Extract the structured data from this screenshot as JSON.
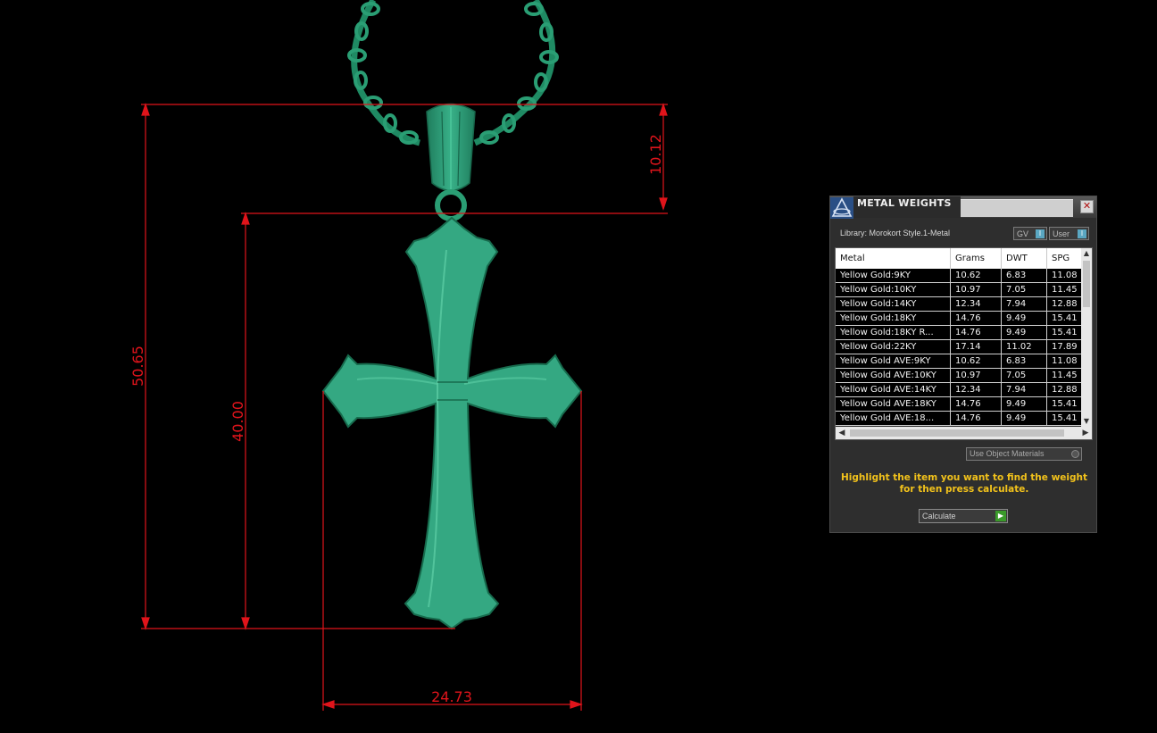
{
  "viewport": {
    "dimensions": {
      "overall_height": "50.65",
      "cross_height": "40.00",
      "bail_height": "10.12",
      "width": "24.73"
    },
    "colors": {
      "metal": "#2f9e77",
      "dimension_lines": "#e0141b",
      "background": "#000000"
    }
  },
  "panel": {
    "title": "METAL WEIGHTS",
    "close_icon": "close-icon",
    "library": "Library: Morokort Style.1-Metal",
    "toggle_gv": "GV",
    "toggle_user": "User",
    "toggle_knob": "I",
    "columns": [
      "Metal",
      "Grams",
      "DWT",
      "SPG"
    ],
    "rows": [
      [
        "Yellow Gold:9KY",
        "10.62",
        "6.83",
        "11.08"
      ],
      [
        "Yellow Gold:10KY",
        "10.97",
        "7.05",
        "11.45"
      ],
      [
        "Yellow Gold:14KY",
        "12.34",
        "7.94",
        "12.88"
      ],
      [
        "Yellow Gold:18KY",
        "14.76",
        "9.49",
        "15.41"
      ],
      [
        "Yellow Gold:18KY R...",
        "14.76",
        "9.49",
        "15.41"
      ],
      [
        "Yellow Gold:22KY",
        "17.14",
        "11.02",
        "17.89"
      ],
      [
        "Yellow Gold AVE:9KY",
        "10.62",
        "6.83",
        "11.08"
      ],
      [
        "Yellow Gold AVE:10KY",
        "10.97",
        "7.05",
        "11.45"
      ],
      [
        "Yellow Gold AVE:14KY",
        "12.34",
        "7.94",
        "12.88"
      ],
      [
        "Yellow Gold AVE:18KY",
        "14.76",
        "9.49",
        "15.41"
      ],
      [
        "Yellow Gold AVE:18...",
        "14.76",
        "9.49",
        "15.41"
      ]
    ],
    "use_object_materials": "Use Object Materials",
    "hint": "Highlight the item you want to find the weight for then press calculate.",
    "calculate": "Calculate",
    "accent_color": "#f2c21b"
  }
}
